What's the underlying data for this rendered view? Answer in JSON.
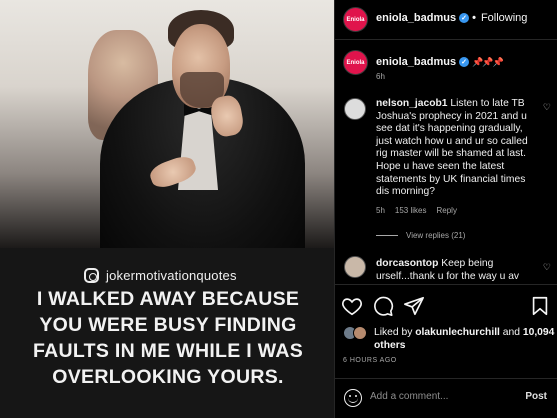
{
  "post": {
    "image_handle": "jokermotivationquotes",
    "quote_lines": [
      "I WALKED AWAY BECAUSE",
      "YOU WERE BUSY FINDING",
      "FAULTS IN ME WHILE I WAS",
      "OVERLOOKING YOURS."
    ]
  },
  "header": {
    "username": "eniola_badmus",
    "avatar_text": "Eniola",
    "separator": "•",
    "follow_status": "Following"
  },
  "caption": {
    "username": "eniola_badmus",
    "pins": "📌📌📌",
    "time": "6h"
  },
  "comments": [
    {
      "username": "nelson_jacob1",
      "text": "Listen to late TB Joshua's prophecy in 2021 and u see dat it's happening gradually, just watch how u and ur so called rig master will be shamed at last. Hope u have seen the latest statements by UK financial times dis morning?",
      "time": "5h",
      "likes": "153 likes",
      "reply": "Reply",
      "view_replies": "View replies (21)"
    },
    {
      "username": "dorcasontop",
      "text": "Keep being urself...thank u for the way u av"
    }
  ],
  "actions": {
    "like_icon": "heart-icon",
    "comment_icon": "comment-icon",
    "share_icon": "send-icon",
    "save_icon": "bookmark-icon"
  },
  "likes": {
    "prefix": "Liked by",
    "user": "olakunlechurchill",
    "and": "and",
    "others": "10,094 others"
  },
  "posted": "6 HOURS AGO",
  "add_comment": {
    "placeholder": "Add a comment...",
    "post_label": "Post"
  },
  "colors": {
    "brand_avatar": "#e0144c",
    "verified": "#3897f0",
    "muted": "#a8a8a8"
  }
}
